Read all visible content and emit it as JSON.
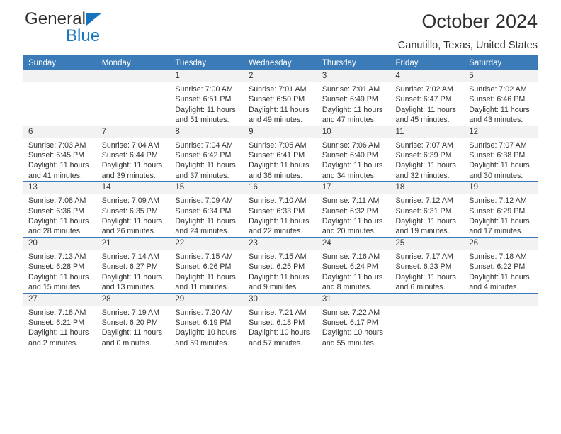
{
  "brand": {
    "name_top": "General",
    "name_bottom": "Blue",
    "triangle_icon": "triangle-icon",
    "accent_color": "#1778c0"
  },
  "header": {
    "title": "October 2024",
    "subtitle": "Canutillo, Texas, United States"
  },
  "theme": {
    "header_row_bg": "#3b7cb8",
    "date_band_bg": "#f2f2f2",
    "text_color": "#333333"
  },
  "weekday_headers": [
    "Sunday",
    "Monday",
    "Tuesday",
    "Wednesday",
    "Thursday",
    "Friday",
    "Saturday"
  ],
  "weeks": [
    [
      {
        "date": "",
        "empty": true,
        "sunrise": "",
        "sunset": "",
        "daylight_line1": "",
        "daylight_line2": ""
      },
      {
        "date": "",
        "empty": true,
        "sunrise": "",
        "sunset": "",
        "daylight_line1": "",
        "daylight_line2": ""
      },
      {
        "date": "1",
        "sunrise": "Sunrise: 7:00 AM",
        "sunset": "Sunset: 6:51 PM",
        "daylight_line1": "Daylight: 11 hours",
        "daylight_line2": "and 51 minutes."
      },
      {
        "date": "2",
        "sunrise": "Sunrise: 7:01 AM",
        "sunset": "Sunset: 6:50 PM",
        "daylight_line1": "Daylight: 11 hours",
        "daylight_line2": "and 49 minutes."
      },
      {
        "date": "3",
        "sunrise": "Sunrise: 7:01 AM",
        "sunset": "Sunset: 6:49 PM",
        "daylight_line1": "Daylight: 11 hours",
        "daylight_line2": "and 47 minutes."
      },
      {
        "date": "4",
        "sunrise": "Sunrise: 7:02 AM",
        "sunset": "Sunset: 6:47 PM",
        "daylight_line1": "Daylight: 11 hours",
        "daylight_line2": "and 45 minutes."
      },
      {
        "date": "5",
        "sunrise": "Sunrise: 7:02 AM",
        "sunset": "Sunset: 6:46 PM",
        "daylight_line1": "Daylight: 11 hours",
        "daylight_line2": "and 43 minutes."
      }
    ],
    [
      {
        "date": "6",
        "sunrise": "Sunrise: 7:03 AM",
        "sunset": "Sunset: 6:45 PM",
        "daylight_line1": "Daylight: 11 hours",
        "daylight_line2": "and 41 minutes."
      },
      {
        "date": "7",
        "sunrise": "Sunrise: 7:04 AM",
        "sunset": "Sunset: 6:44 PM",
        "daylight_line1": "Daylight: 11 hours",
        "daylight_line2": "and 39 minutes."
      },
      {
        "date": "8",
        "sunrise": "Sunrise: 7:04 AM",
        "sunset": "Sunset: 6:42 PM",
        "daylight_line1": "Daylight: 11 hours",
        "daylight_line2": "and 37 minutes."
      },
      {
        "date": "9",
        "sunrise": "Sunrise: 7:05 AM",
        "sunset": "Sunset: 6:41 PM",
        "daylight_line1": "Daylight: 11 hours",
        "daylight_line2": "and 36 minutes."
      },
      {
        "date": "10",
        "sunrise": "Sunrise: 7:06 AM",
        "sunset": "Sunset: 6:40 PM",
        "daylight_line1": "Daylight: 11 hours",
        "daylight_line2": "and 34 minutes."
      },
      {
        "date": "11",
        "sunrise": "Sunrise: 7:07 AM",
        "sunset": "Sunset: 6:39 PM",
        "daylight_line1": "Daylight: 11 hours",
        "daylight_line2": "and 32 minutes."
      },
      {
        "date": "12",
        "sunrise": "Sunrise: 7:07 AM",
        "sunset": "Sunset: 6:38 PM",
        "daylight_line1": "Daylight: 11 hours",
        "daylight_line2": "and 30 minutes."
      }
    ],
    [
      {
        "date": "13",
        "sunrise": "Sunrise: 7:08 AM",
        "sunset": "Sunset: 6:36 PM",
        "daylight_line1": "Daylight: 11 hours",
        "daylight_line2": "and 28 minutes."
      },
      {
        "date": "14",
        "sunrise": "Sunrise: 7:09 AM",
        "sunset": "Sunset: 6:35 PM",
        "daylight_line1": "Daylight: 11 hours",
        "daylight_line2": "and 26 minutes."
      },
      {
        "date": "15",
        "sunrise": "Sunrise: 7:09 AM",
        "sunset": "Sunset: 6:34 PM",
        "daylight_line1": "Daylight: 11 hours",
        "daylight_line2": "and 24 minutes."
      },
      {
        "date": "16",
        "sunrise": "Sunrise: 7:10 AM",
        "sunset": "Sunset: 6:33 PM",
        "daylight_line1": "Daylight: 11 hours",
        "daylight_line2": "and 22 minutes."
      },
      {
        "date": "17",
        "sunrise": "Sunrise: 7:11 AM",
        "sunset": "Sunset: 6:32 PM",
        "daylight_line1": "Daylight: 11 hours",
        "daylight_line2": "and 20 minutes."
      },
      {
        "date": "18",
        "sunrise": "Sunrise: 7:12 AM",
        "sunset": "Sunset: 6:31 PM",
        "daylight_line1": "Daylight: 11 hours",
        "daylight_line2": "and 19 minutes."
      },
      {
        "date": "19",
        "sunrise": "Sunrise: 7:12 AM",
        "sunset": "Sunset: 6:29 PM",
        "daylight_line1": "Daylight: 11 hours",
        "daylight_line2": "and 17 minutes."
      }
    ],
    [
      {
        "date": "20",
        "sunrise": "Sunrise: 7:13 AM",
        "sunset": "Sunset: 6:28 PM",
        "daylight_line1": "Daylight: 11 hours",
        "daylight_line2": "and 15 minutes."
      },
      {
        "date": "21",
        "sunrise": "Sunrise: 7:14 AM",
        "sunset": "Sunset: 6:27 PM",
        "daylight_line1": "Daylight: 11 hours",
        "daylight_line2": "and 13 minutes."
      },
      {
        "date": "22",
        "sunrise": "Sunrise: 7:15 AM",
        "sunset": "Sunset: 6:26 PM",
        "daylight_line1": "Daylight: 11 hours",
        "daylight_line2": "and 11 minutes."
      },
      {
        "date": "23",
        "sunrise": "Sunrise: 7:15 AM",
        "sunset": "Sunset: 6:25 PM",
        "daylight_line1": "Daylight: 11 hours",
        "daylight_line2": "and 9 minutes."
      },
      {
        "date": "24",
        "sunrise": "Sunrise: 7:16 AM",
        "sunset": "Sunset: 6:24 PM",
        "daylight_line1": "Daylight: 11 hours",
        "daylight_line2": "and 8 minutes."
      },
      {
        "date": "25",
        "sunrise": "Sunrise: 7:17 AM",
        "sunset": "Sunset: 6:23 PM",
        "daylight_line1": "Daylight: 11 hours",
        "daylight_line2": "and 6 minutes."
      },
      {
        "date": "26",
        "sunrise": "Sunrise: 7:18 AM",
        "sunset": "Sunset: 6:22 PM",
        "daylight_line1": "Daylight: 11 hours",
        "daylight_line2": "and 4 minutes."
      }
    ],
    [
      {
        "date": "27",
        "sunrise": "Sunrise: 7:18 AM",
        "sunset": "Sunset: 6:21 PM",
        "daylight_line1": "Daylight: 11 hours",
        "daylight_line2": "and 2 minutes."
      },
      {
        "date": "28",
        "sunrise": "Sunrise: 7:19 AM",
        "sunset": "Sunset: 6:20 PM",
        "daylight_line1": "Daylight: 11 hours",
        "daylight_line2": "and 0 minutes."
      },
      {
        "date": "29",
        "sunrise": "Sunrise: 7:20 AM",
        "sunset": "Sunset: 6:19 PM",
        "daylight_line1": "Daylight: 10 hours",
        "daylight_line2": "and 59 minutes."
      },
      {
        "date": "30",
        "sunrise": "Sunrise: 7:21 AM",
        "sunset": "Sunset: 6:18 PM",
        "daylight_line1": "Daylight: 10 hours",
        "daylight_line2": "and 57 minutes."
      },
      {
        "date": "31",
        "sunrise": "Sunrise: 7:22 AM",
        "sunset": "Sunset: 6:17 PM",
        "daylight_line1": "Daylight: 10 hours",
        "daylight_line2": "and 55 minutes."
      },
      {
        "date": "",
        "empty": true,
        "sunrise": "",
        "sunset": "",
        "daylight_line1": "",
        "daylight_line2": ""
      },
      {
        "date": "",
        "empty": true,
        "sunrise": "",
        "sunset": "",
        "daylight_line1": "",
        "daylight_line2": ""
      }
    ]
  ]
}
